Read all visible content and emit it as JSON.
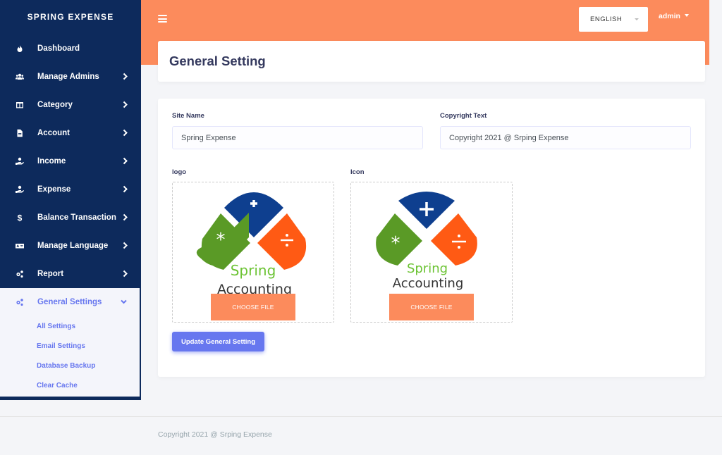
{
  "brand": "SPRING EXPENSE",
  "sidebar": {
    "items": [
      {
        "label": "Dashboard",
        "icon": "fire-icon"
      },
      {
        "label": "Manage Admins",
        "icon": "users-icon"
      },
      {
        "label": "Category",
        "icon": "columns-icon"
      },
      {
        "label": "Account",
        "icon": "file-icon"
      },
      {
        "label": "Income",
        "icon": "hand-holding-icon"
      },
      {
        "label": "Expense",
        "icon": "hand-holding-icon"
      },
      {
        "label": "Balance Transaction",
        "icon": "dollar-icon"
      },
      {
        "label": "Manage Language",
        "icon": "language-icon"
      },
      {
        "label": "Report",
        "icon": "cogs-icon"
      }
    ],
    "active": {
      "label": "General Settings",
      "icon": "cogs-icon",
      "sub": [
        "All Settings",
        "Email Settings",
        "Database Backup",
        "Clear Cache"
      ]
    }
  },
  "topbar": {
    "language": "ENGLISH",
    "user": "admin"
  },
  "page": {
    "title": "General Setting"
  },
  "form": {
    "site_name_label": "Site Name",
    "site_name_value": "Spring Expense",
    "copyright_label": "Copyright Text",
    "copyright_value": "Copyright 2021 @ Srping Expense",
    "logo_label": "logo",
    "icon_label": "Icon",
    "choose_file": "CHOOSE FILE",
    "submit": "Update General Setting"
  },
  "logo_art": {
    "word1": "Spring",
    "word2": "Accounting"
  },
  "footer": "Copyright 2021 @ Srping Expense",
  "colors": {
    "sidebar": "#0d2a5c",
    "accent_orange": "#fc8b5c",
    "accent_primary": "#6777ef",
    "logo_blue": "#0e3f8f",
    "logo_green": "#5a9a26",
    "logo_orange": "#ff5a14"
  }
}
